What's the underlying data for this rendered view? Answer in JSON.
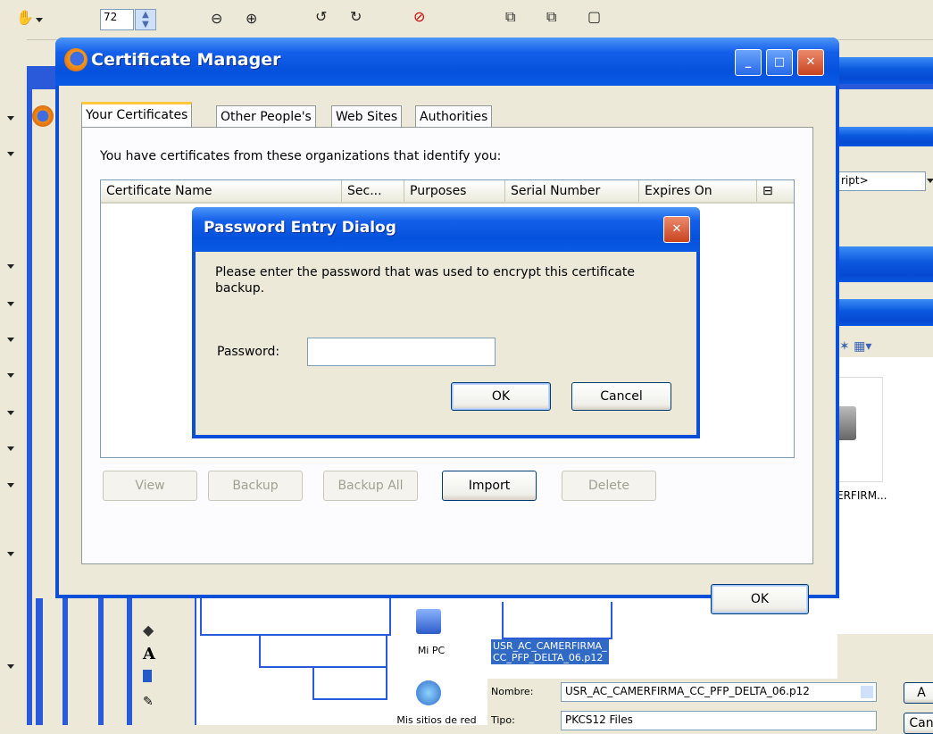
{
  "background": {
    "zoom_value": "72",
    "partial_dropdown_text": "ript>",
    "file_tile_label": "ERFIRM...",
    "selected_file": "USR_AC_CAMERFIRMA_\nCC_PFP_DELTA_06.p12",
    "nav": [
      {
        "label": "Mi PC",
        "icon": "my-computer-icon"
      },
      {
        "label": "Mis sitios de red",
        "icon": "network-icon"
      }
    ],
    "filename_label": "Nombre:",
    "filename_value": "USR_AC_CAMERFIRMA_CC_PFP_DELTA_06.p12",
    "filetype_label": "Tipo:",
    "filetype_value": "PKCS12 Files",
    "button_a": "A",
    "button_c": "Can"
  },
  "cert_manager": {
    "title": "Certificate Manager",
    "tabs": [
      "Your Certificates",
      "Other People's",
      "Web Sites",
      "Authorities"
    ],
    "intro": "You have certificates from these organizations that identify you:",
    "columns": [
      "Certificate Name",
      "Sec...",
      "Purposes",
      "Serial Number",
      "Expires On"
    ],
    "buttons": {
      "view": "View",
      "backup": "Backup",
      "backup_all": "Backup All",
      "import": "Import",
      "delete": "Delete"
    },
    "ok": "OK"
  },
  "password_dialog": {
    "title": "Password Entry Dialog",
    "message": "Please enter the password that was used to encrypt this certificate backup.",
    "password_label": "Password:",
    "password_value": "",
    "ok": "OK",
    "cancel": "Cancel"
  },
  "colors": {
    "title_blue": "#0451dc",
    "dialog_bg": "#ece9d8",
    "tab_accent": "#ffc83c"
  }
}
